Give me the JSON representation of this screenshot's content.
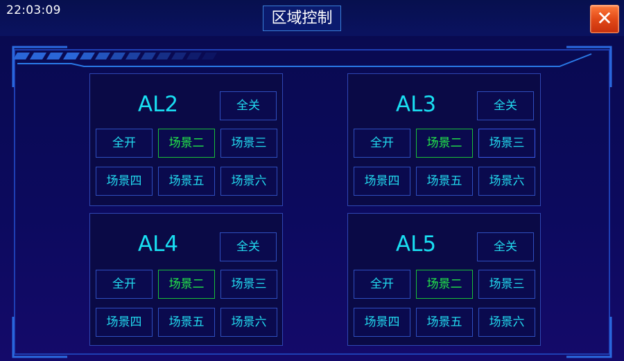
{
  "header": {
    "time": "22:03:09",
    "title": "区域控制",
    "close_label": "✕"
  },
  "panels": [
    {
      "name": "AL2",
      "buttons": {
        "all_off": "全关",
        "all_on": "全开",
        "scene2": "场景二",
        "scene3": "场景三",
        "scene4": "场景四",
        "scene5": "场景五",
        "scene6": "场景六"
      }
    },
    {
      "name": "AL3",
      "buttons": {
        "all_off": "全关",
        "all_on": "全开",
        "scene2": "场景二",
        "scene3": "场景三",
        "scene4": "场景四",
        "scene5": "场景五",
        "scene6": "场景六"
      }
    },
    {
      "name": "AL4",
      "buttons": {
        "all_off": "全关",
        "all_on": "全开",
        "scene2": "场景二",
        "scene3": "场景三",
        "scene4": "场景四",
        "scene5": "场景五",
        "scene6": "场景六"
      }
    },
    {
      "name": "AL5",
      "buttons": {
        "all_off": "全关",
        "all_on": "全开",
        "scene2": "场景二",
        "scene3": "场景三",
        "scene4": "场景四",
        "scene5": "场景五",
        "scene6": "场景六"
      }
    }
  ],
  "colors": {
    "accent_cyan": "#22dcf0",
    "active_green": "#22e84a",
    "border_blue": "#2f4fc0",
    "close_orange": "#e24a18"
  }
}
